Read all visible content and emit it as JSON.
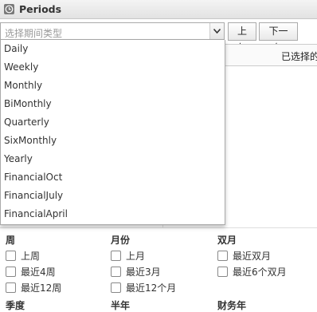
{
  "window": {
    "title": "Periods"
  },
  "selector": {
    "placeholder": "选择期间类型"
  },
  "buttons": {
    "previous": "上年",
    "next": "下一年"
  },
  "selected_panel": {
    "header": "已选择的"
  },
  "dropdown": {
    "options": [
      "Daily",
      "Weekly",
      "Monthly",
      "BiMonthly",
      "Quarterly",
      "SixMonthly",
      "Yearly",
      "FinancialOct",
      "FinancialJuly",
      "FinancialApril"
    ]
  },
  "groups": {
    "week": {
      "title": "周",
      "items": [
        "上周",
        "最近4周",
        "最近12周"
      ]
    },
    "month": {
      "title": "月份",
      "items": [
        "上月",
        "最近3月",
        "最近12个月"
      ]
    },
    "bimonth": {
      "title": "双月",
      "items": [
        "最近双月",
        "最近6个双月"
      ]
    },
    "partial_bottom": [
      "季度",
      "半年",
      "财务年"
    ]
  },
  "icons": {
    "title": "clock-icon",
    "select": "chevron-down-icon"
  }
}
